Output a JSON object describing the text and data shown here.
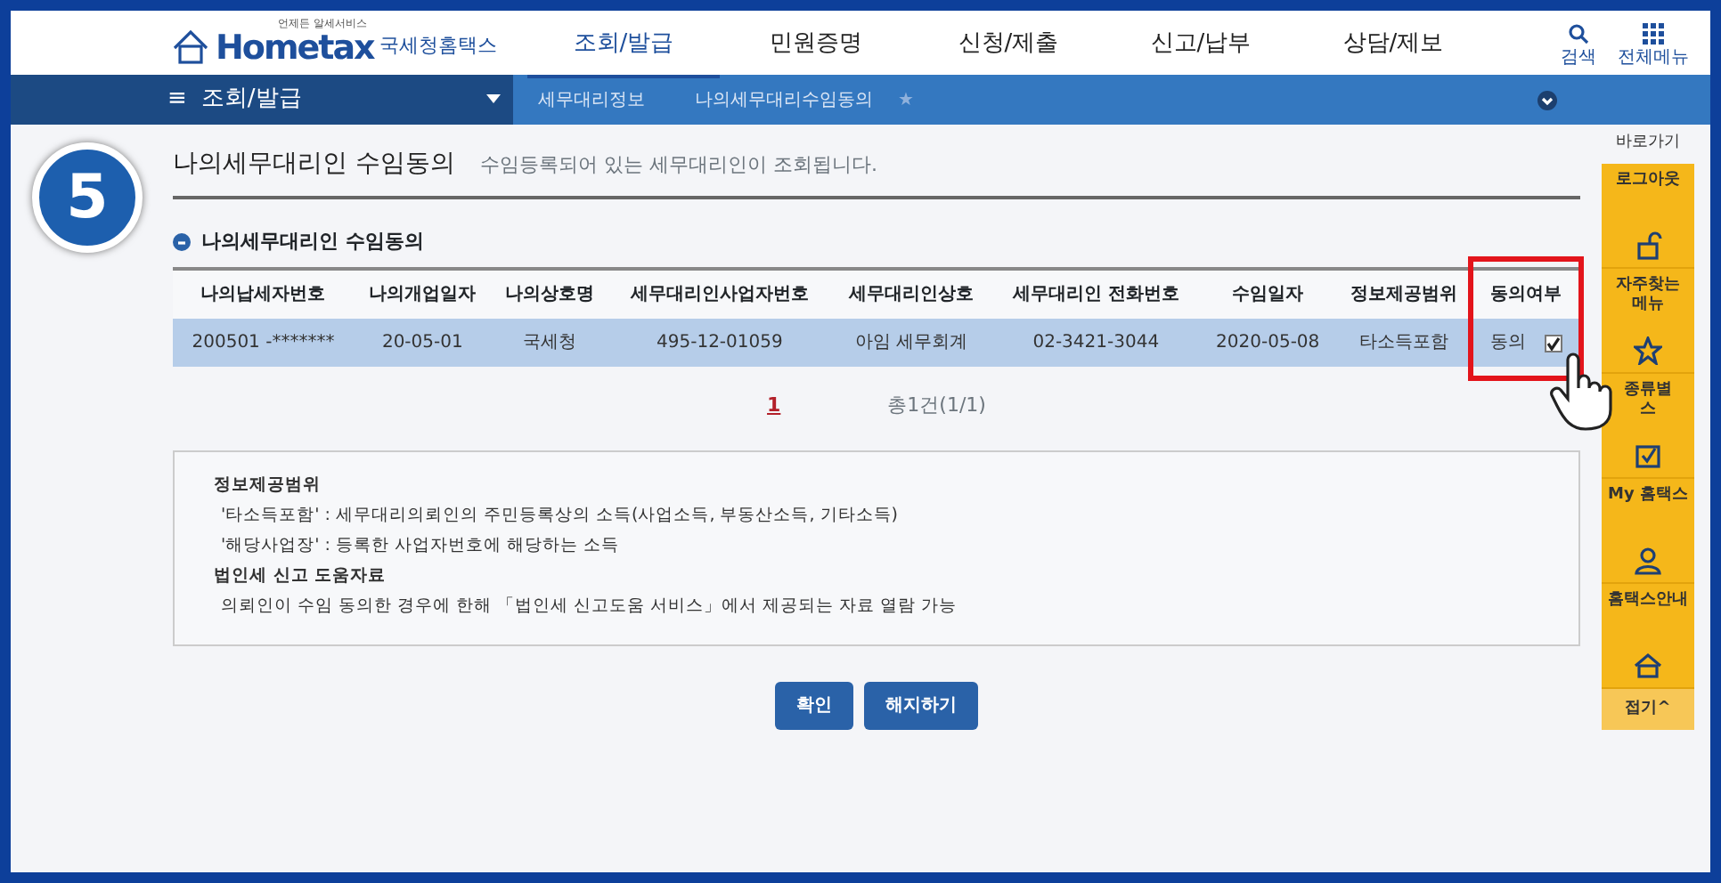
{
  "header": {
    "logo_tagline": "언제든 알세서비스",
    "logo_text": "Hometax",
    "logo_subtitle": "국세청홈택스",
    "menu": [
      {
        "label": "조회/발급",
        "selected": true
      },
      {
        "label": "민원증명",
        "selected": false
      },
      {
        "label": "신청/제출",
        "selected": false
      },
      {
        "label": "신고/납부",
        "selected": false
      },
      {
        "label": "상담/제보",
        "selected": false
      }
    ],
    "tools": [
      {
        "kind": "search",
        "label": "검색"
      },
      {
        "kind": "menu",
        "label": "전체메뉴"
      }
    ]
  },
  "subnav": {
    "menu_glyph": "≡",
    "section": "조회/발급",
    "breadcrumbs": [
      "세무대리정보",
      "나의세무대리수임동의"
    ],
    "favorite_glyph": "★"
  },
  "step_badge": "5",
  "page": {
    "title": "나의세무대리인 수임동의",
    "description": "수임등록되어 있는 세무대리인이 조회됩니다.",
    "section_title": "나의세무대리인 수임동의"
  },
  "table": {
    "columns": [
      {
        "label": "나의납세자번호",
        "highlighted": false
      },
      {
        "label": "나의개업일자",
        "highlighted": false
      },
      {
        "label": "나의상호명",
        "highlighted": false
      },
      {
        "label": "세무대리인사업자번호",
        "highlighted": false
      },
      {
        "label": "세무대리인상호",
        "highlighted": false
      },
      {
        "label": "세무대리인 전화번호",
        "highlighted": false
      },
      {
        "label": "수임일자",
        "highlighted": false
      },
      {
        "label": "정보제공범위",
        "highlighted": false
      },
      {
        "label": "동의여부",
        "highlighted": true
      }
    ],
    "rows": [
      {
        "selected": true,
        "cells": [
          "200501 -*******",
          "20-05-01",
          "국세청",
          "495-12-01059",
          "아임 세무회계",
          "02-3421-3044",
          "2020-05-08",
          "타소득포함",
          "동의"
        ],
        "checked": true
      }
    ]
  },
  "pagination": {
    "pages": [
      {
        "label": "1",
        "selected": true
      }
    ],
    "total": "총1건(1/1)"
  },
  "notes": [
    {
      "heading": "정보제공범위",
      "items": [
        "'타소득포함' : 세무대리의뢰인의 주민등록상의 소득(사업소득, 부동산소득, 기타소득)",
        "'해당사업장' : 등록한 사업자번호에 해당하는 소득"
      ]
    },
    {
      "heading": "법인세 신고 도움자료",
      "items": [
        "의뢰인이 수임 동의한 경우에 한해 「법인세 신고도움 서비스」에서 제공되는 자료 열람 가능"
      ]
    }
  ],
  "buttons": [
    {
      "label": "확인"
    },
    {
      "label": "해지하기"
    }
  ],
  "quick_links": {
    "title": "바로가기",
    "items": [
      {
        "kind": "lock",
        "lines": [
          "로그아웃"
        ]
      },
      {
        "kind": "star",
        "lines": [
          "자주찾는",
          "메뉴"
        ]
      },
      {
        "kind": "check",
        "lines": [
          "종류별",
          "스"
        ]
      },
      {
        "kind": "person",
        "lines": [
          "My 홈택스"
        ]
      },
      {
        "kind": "house",
        "lines": [
          "홈택스안내"
        ]
      }
    ],
    "collapse": "접기^"
  }
}
